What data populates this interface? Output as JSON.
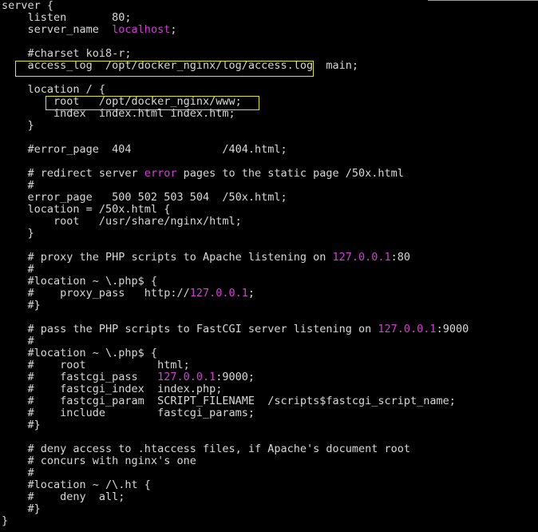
{
  "colors": {
    "background": "#000000",
    "text": "#d8d8d8",
    "highlight_keyword": "#d23fd2",
    "annotation_box": "#e6e600"
  },
  "lines": [
    [
      {
        "t": "server {",
        "c": "plain"
      }
    ],
    [
      {
        "t": "    listen       80;",
        "c": "plain"
      }
    ],
    [
      {
        "t": "    server_name  ",
        "c": "plain"
      },
      {
        "t": "localhost",
        "c": "hl"
      },
      {
        "t": ";",
        "c": "plain"
      }
    ],
    [
      {
        "t": "",
        "c": "plain"
      }
    ],
    [
      {
        "t": "    #charset koi8-r;",
        "c": "plain"
      }
    ],
    [
      {
        "t": "    access_log  /opt/docker_nginx/log/access.log  main;",
        "c": "plain"
      }
    ],
    [
      {
        "t": "",
        "c": "plain"
      }
    ],
    [
      {
        "t": "    location / {",
        "c": "plain"
      }
    ],
    [
      {
        "t": "        root   /opt/docker_nginx/www;",
        "c": "plain"
      }
    ],
    [
      {
        "t": "        index  index.html index.htm;",
        "c": "plain"
      }
    ],
    [
      {
        "t": "    }",
        "c": "plain"
      }
    ],
    [
      {
        "t": "",
        "c": "plain"
      }
    ],
    [
      {
        "t": "    #error_page  404              /404.html;",
        "c": "plain"
      }
    ],
    [
      {
        "t": "",
        "c": "plain"
      }
    ],
    [
      {
        "t": "    # redirect server ",
        "c": "plain"
      },
      {
        "t": "error",
        "c": "hl"
      },
      {
        "t": " pages to the static page /50x.html",
        "c": "plain"
      }
    ],
    [
      {
        "t": "    #",
        "c": "plain"
      }
    ],
    [
      {
        "t": "    error_page   500 502 503 504  /50x.html;",
        "c": "plain"
      }
    ],
    [
      {
        "t": "    location = /50x.html {",
        "c": "plain"
      }
    ],
    [
      {
        "t": "        root   /usr/share/nginx/html;",
        "c": "plain"
      }
    ],
    [
      {
        "t": "    }",
        "c": "plain"
      }
    ],
    [
      {
        "t": "",
        "c": "plain"
      }
    ],
    [
      {
        "t": "    # proxy the PHP scripts to Apache listening on ",
        "c": "plain"
      },
      {
        "t": "127.0.0.1",
        "c": "hl"
      },
      {
        "t": ":80",
        "c": "plain"
      }
    ],
    [
      {
        "t": "    #",
        "c": "plain"
      }
    ],
    [
      {
        "t": "    #location ~ \\.php$ {",
        "c": "plain"
      }
    ],
    [
      {
        "t": "    #    proxy_pass   http://",
        "c": "plain"
      },
      {
        "t": "127.0.0.1",
        "c": "hl"
      },
      {
        "t": ";",
        "c": "plain"
      }
    ],
    [
      {
        "t": "    #}",
        "c": "plain"
      }
    ],
    [
      {
        "t": "",
        "c": "plain"
      }
    ],
    [
      {
        "t": "    # pass the PHP scripts to FastCGI server listening on ",
        "c": "plain"
      },
      {
        "t": "127.0.0.1",
        "c": "hl"
      },
      {
        "t": ":9000",
        "c": "plain"
      }
    ],
    [
      {
        "t": "    #",
        "c": "plain"
      }
    ],
    [
      {
        "t": "    #location ~ \\.php$ {",
        "c": "plain"
      }
    ],
    [
      {
        "t": "    #    root           html;",
        "c": "plain"
      }
    ],
    [
      {
        "t": "    #    fastcgi_pass   ",
        "c": "plain"
      },
      {
        "t": "127.0.0.1",
        "c": "hl"
      },
      {
        "t": ":9000;",
        "c": "plain"
      }
    ],
    [
      {
        "t": "    #    fastcgi_index  index.php;",
        "c": "plain"
      }
    ],
    [
      {
        "t": "    #    fastcgi_param  SCRIPT_FILENAME  /scripts$fastcgi_script_name;",
        "c": "plain"
      }
    ],
    [
      {
        "t": "    #    include        fastcgi_params;",
        "c": "plain"
      }
    ],
    [
      {
        "t": "    #}",
        "c": "plain"
      }
    ],
    [
      {
        "t": "",
        "c": "plain"
      }
    ],
    [
      {
        "t": "    # deny access to .htaccess files, if Apache's document root",
        "c": "plain"
      }
    ],
    [
      {
        "t": "    # concurs with nginx's one",
        "c": "plain"
      }
    ],
    [
      {
        "t": "    #",
        "c": "plain"
      }
    ],
    [
      {
        "t": "    #location ~ /\\.ht {",
        "c": "plain"
      }
    ],
    [
      {
        "t": "    #    deny  all;",
        "c": "plain"
      }
    ],
    [
      {
        "t": "    #}",
        "c": "plain"
      }
    ],
    [
      {
        "t": "}",
        "c": "plain"
      }
    ]
  ]
}
